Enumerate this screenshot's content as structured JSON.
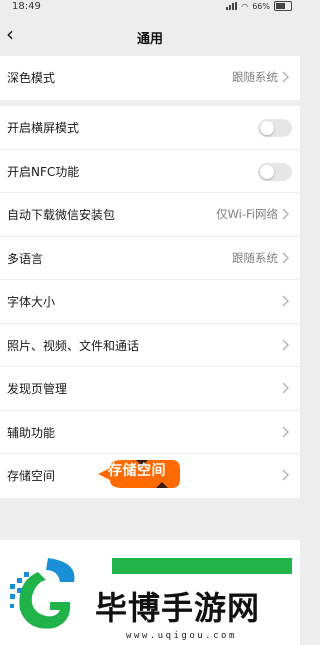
{
  "status_bar": {
    "time": "18:49",
    "battery": "66%"
  },
  "nav": {
    "back_icon": "chevron-left-icon",
    "title": "通用"
  },
  "group1": [
    {
      "label": "深色模式",
      "value": "跟随系统"
    }
  ],
  "group2": [
    {
      "label": "开启横屏模式",
      "toggle": false
    },
    {
      "label": "开启NFC功能",
      "toggle": false
    },
    {
      "label": "自动下载微信安装包",
      "value": "仅Wi-Fi网络"
    },
    {
      "label": "多语言",
      "value": "跟随系统"
    },
    {
      "label": "字体大小"
    },
    {
      "label": "照片、视频、文件和通话"
    },
    {
      "label": "发现页管理"
    },
    {
      "label": "辅助功能"
    },
    {
      "label": "存储空间"
    }
  ],
  "annotation": {
    "text": "存储空间",
    "color": "#ff6a00"
  },
  "watermark": {
    "brand": "毕博手游网",
    "url": "www.uqigou.com",
    "accent": "#1fb34a"
  }
}
